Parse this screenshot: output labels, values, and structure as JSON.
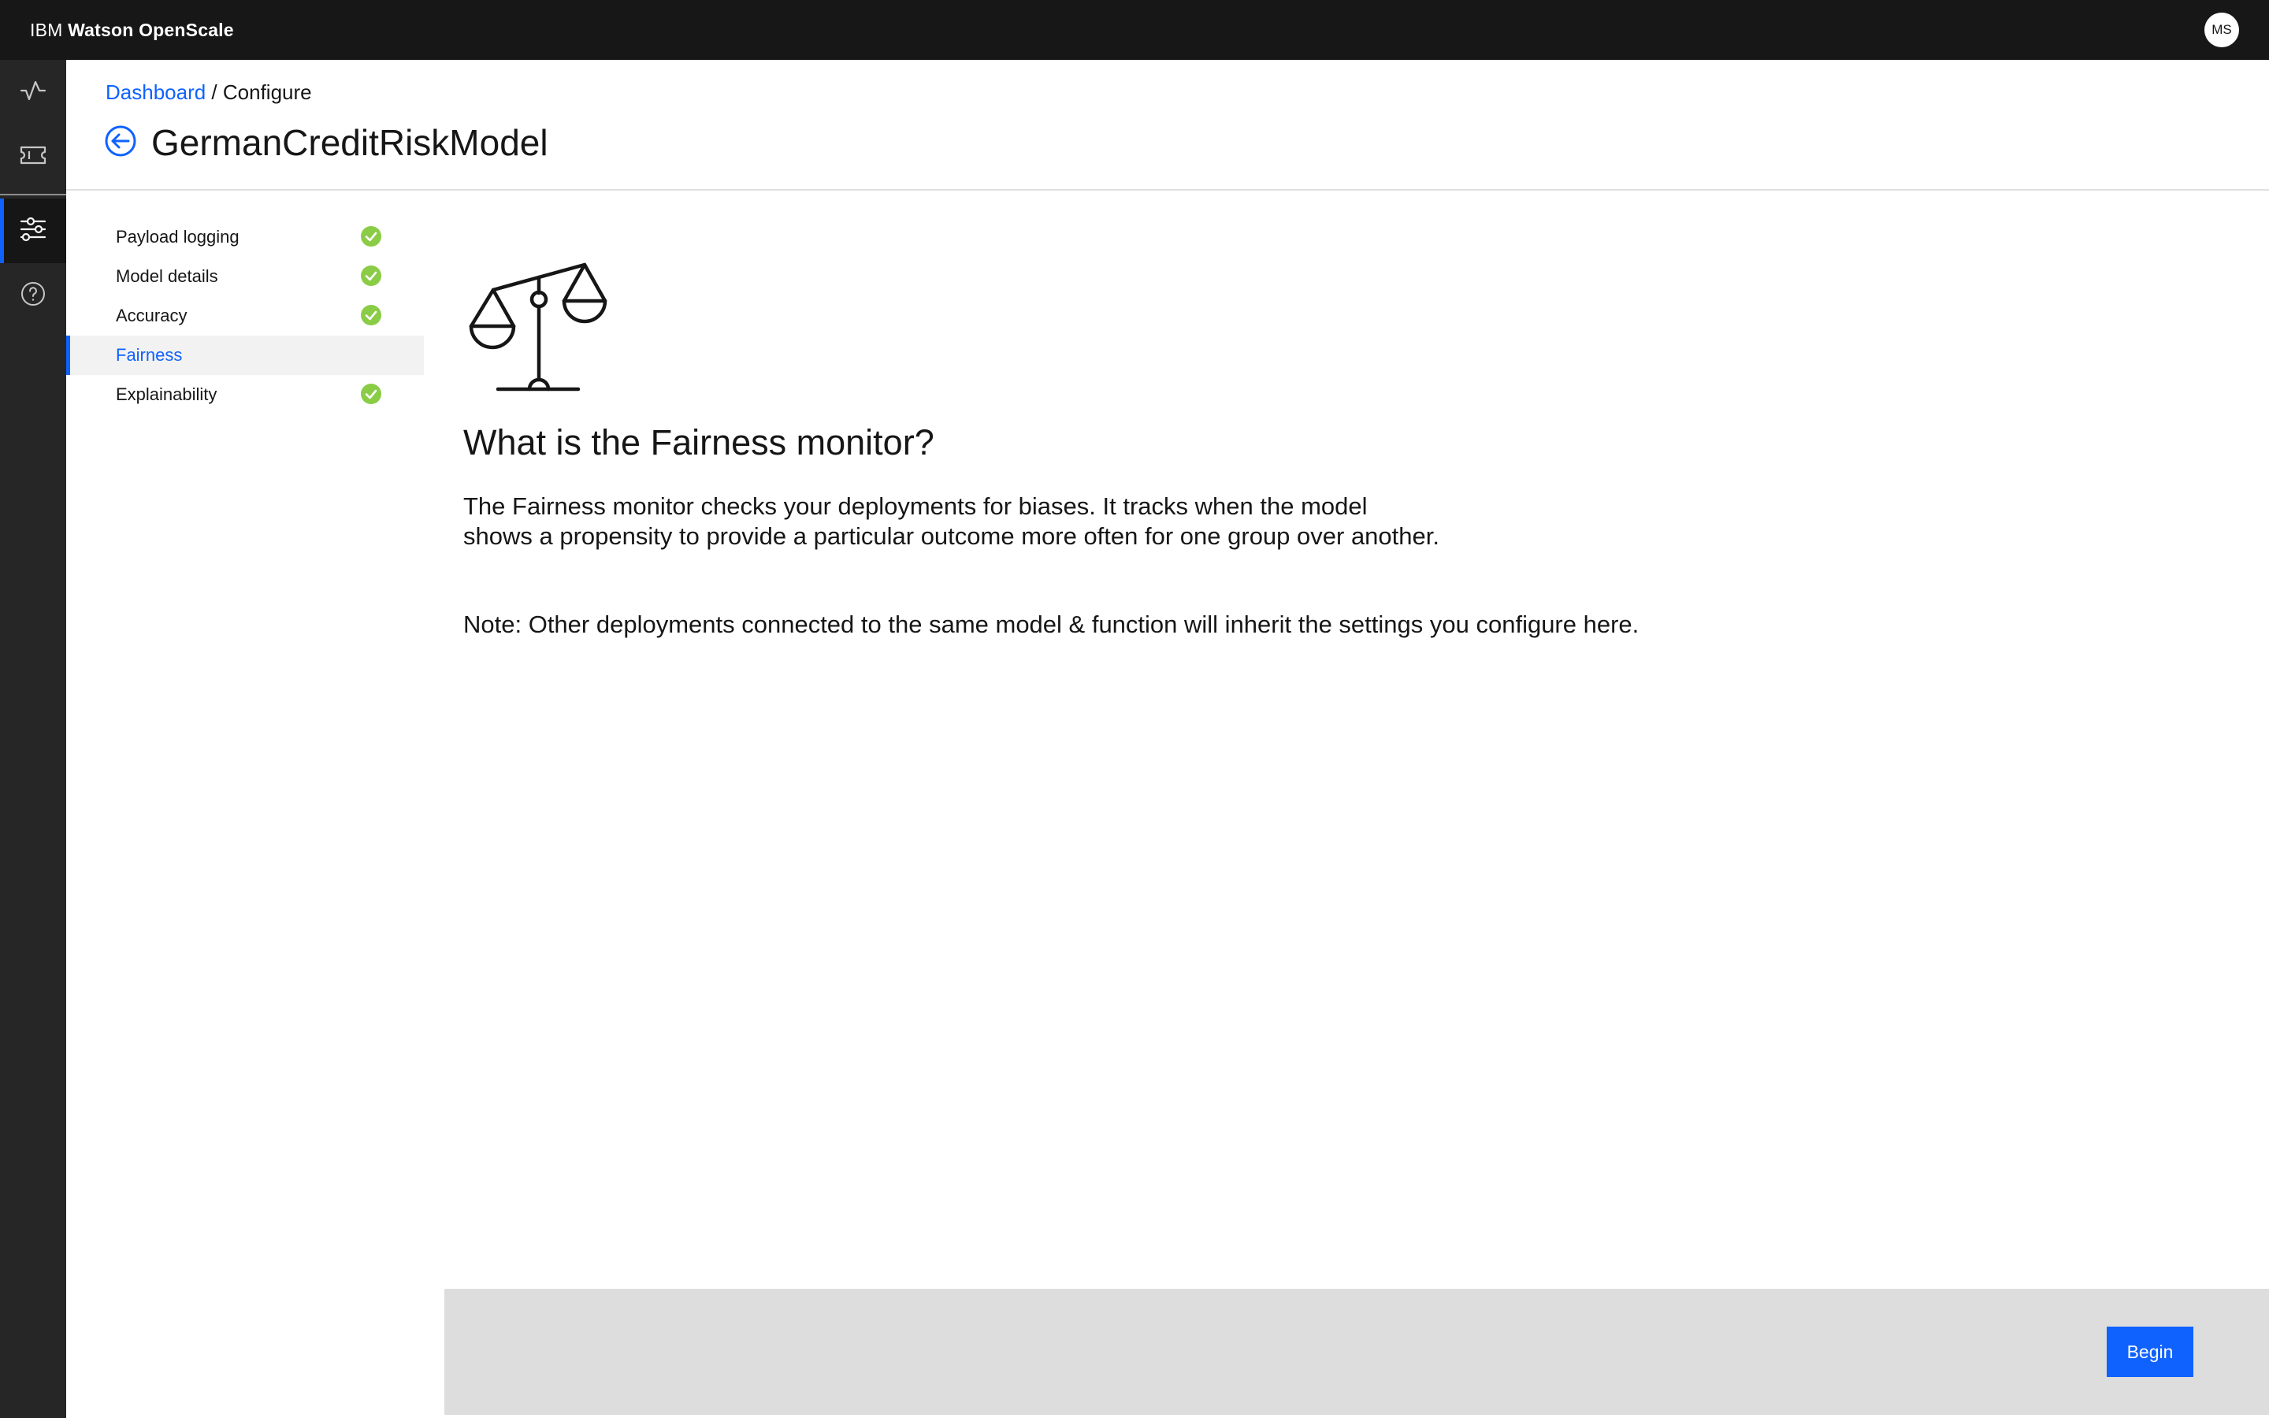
{
  "header": {
    "brand_prefix": "IBM ",
    "brand_name": "Watson OpenScale",
    "avatar_initials": "MS"
  },
  "rail": {
    "items": [
      {
        "icon": "activity-icon",
        "active": false
      },
      {
        "icon": "ticket-icon",
        "active": false
      },
      {
        "icon": "settings-adjust-icon",
        "active": true
      },
      {
        "icon": "help-icon",
        "active": false
      }
    ]
  },
  "breadcrumb": {
    "link": "Dashboard",
    "separator": " / ",
    "current": "Configure"
  },
  "page": {
    "title": "GermanCreditRiskModel",
    "back_icon": "arrow-left-icon"
  },
  "config_nav": {
    "items": [
      {
        "label": "Payload logging",
        "complete": true,
        "active": false
      },
      {
        "label": "Model details",
        "complete": true,
        "active": false
      },
      {
        "label": "Accuracy",
        "complete": true,
        "active": false
      },
      {
        "label": "Fairness",
        "complete": false,
        "active": true
      },
      {
        "label": "Explainability",
        "complete": true,
        "active": false
      }
    ]
  },
  "main": {
    "illustration": "scale-icon",
    "heading": "What is the Fairness monitor?",
    "description": "The Fairness monitor checks your deployments for biases. It tracks when the model shows a propensity to provide a particular outcome more often for one group over another.",
    "note": "Note: Other deployments connected to the same model & function will inherit the settings you configure here."
  },
  "footer": {
    "begin_label": "Begin"
  },
  "colors": {
    "accent": "#0f62fe",
    "header_bg": "#171717",
    "rail_bg": "#262626",
    "success": "#8acc45",
    "footer_bg": "#dddddd"
  }
}
